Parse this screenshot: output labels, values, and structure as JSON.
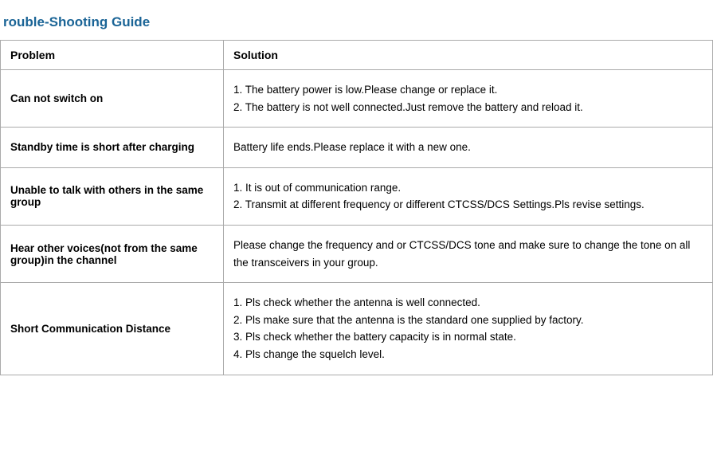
{
  "title": "rouble-Shooting Guide",
  "table": {
    "header": {
      "problem": "Problem",
      "solution": "Solution"
    },
    "rows": [
      {
        "problem": "Can not switch on",
        "solution": "1. The battery power is low.Please change or replace it.\n2. The battery is not well connected.Just remove the battery and reload it."
      },
      {
        "problem": "Standby time is short after charging",
        "solution": "Battery life ends.Please replace it with a new one."
      },
      {
        "problem": "Unable to talk with others in the same group",
        "solution": "1. It is out of communication range.\n2. Transmit at different frequency or different CTCSS/DCS Settings.Pls revise settings."
      },
      {
        "problem": "Hear other voices(not from the same group)in the channel",
        "solution": "Please change the frequency and or CTCSS/DCS tone and make sure to change the tone on all the transceivers in your group."
      },
      {
        "problem": "Short Communication Distance",
        "solution": "1. Pls check whether the antenna is well connected.\n2. Pls make sure that the antenna is the standard one supplied by factory.\n3. Pls check whether the battery capacity is in normal state.\n4. Pls change the squelch level."
      }
    ]
  }
}
